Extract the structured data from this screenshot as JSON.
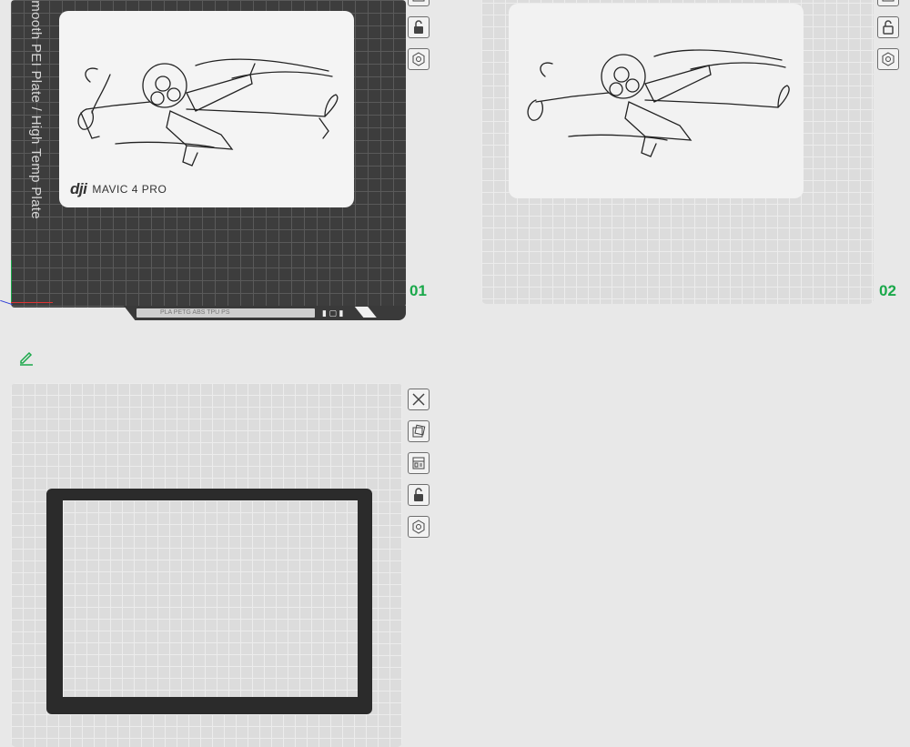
{
  "plates": [
    {
      "number": "01",
      "bed_label": "Smooth PEI Plate / High Temp Plate",
      "strip_label": "PLA PETG ABS TPU PS",
      "logo_brand": "dji",
      "logo_model": "MAVIC 4 PRO"
    },
    {
      "number": "02"
    },
    {
      "number": ""
    }
  ],
  "icons": {
    "tool_buttons": [
      "close-icon",
      "auto-orient-icon",
      "arrange-icon",
      "lock-icon",
      "settings-icon"
    ],
    "edit": "pencil-icon"
  },
  "colors": {
    "accent": "#1aa84a",
    "dark_bed": "#3d3d3d",
    "light_bed": "#dcdcdc",
    "frame": "#2b2b2b"
  }
}
